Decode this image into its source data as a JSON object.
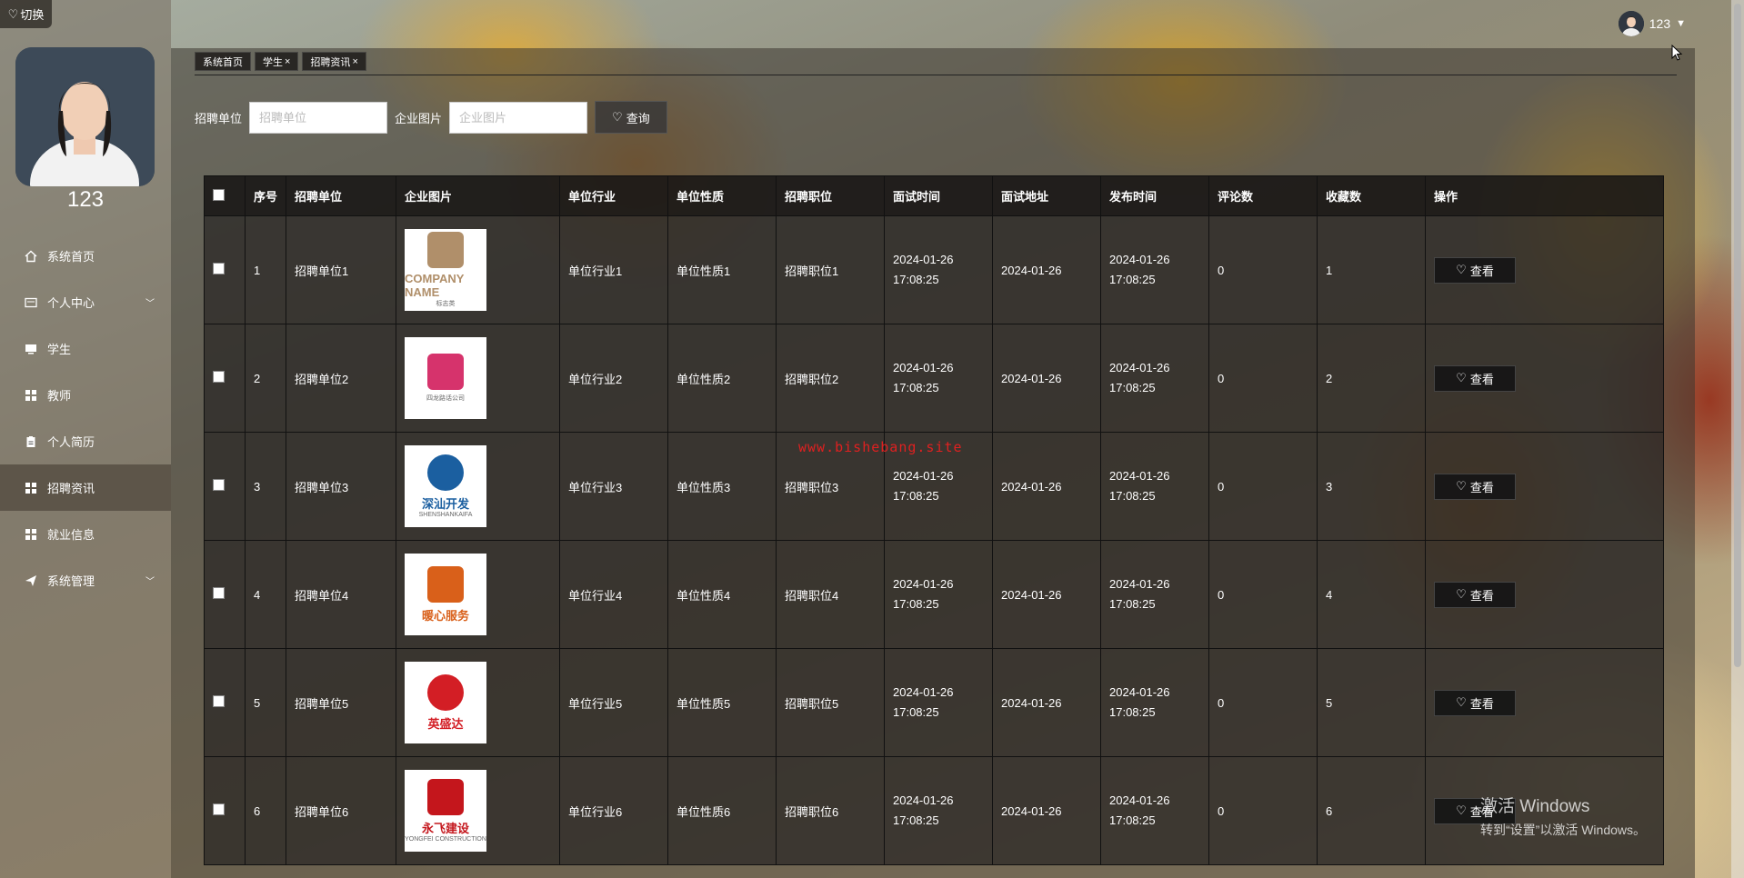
{
  "sidebar": {
    "switch_label": "切换",
    "username": "123",
    "items": [
      {
        "label": "系统首页",
        "icon": "home-icon"
      },
      {
        "label": "个人中心",
        "icon": "id-card-icon",
        "has_submenu": true
      },
      {
        "label": "学生",
        "icon": "monitor-icon"
      },
      {
        "label": "教师",
        "icon": "grid-icon"
      },
      {
        "label": "个人简历",
        "icon": "clipboard-icon"
      },
      {
        "label": "招聘资讯",
        "icon": "grid-icon",
        "active": true
      },
      {
        "label": "就业信息",
        "icon": "grid-icon"
      },
      {
        "label": "系统管理",
        "icon": "paper-plane-icon",
        "has_submenu": true
      }
    ]
  },
  "topbar": {
    "user_label": "123"
  },
  "tags": [
    {
      "label": "系统首页",
      "closable": false
    },
    {
      "label": "学生",
      "closable": true
    },
    {
      "label": "招聘资讯",
      "closable": true
    }
  ],
  "search": {
    "company_label": "招聘单位",
    "company_placeholder": "招聘单位",
    "image_label": "企业图片",
    "image_placeholder": "企业图片",
    "query_button": "查询"
  },
  "table": {
    "headers": [
      "序号",
      "招聘单位",
      "企业图片",
      "单位行业",
      "单位性质",
      "招聘职位",
      "面试时间",
      "面试地址",
      "发布时间",
      "评论数",
      "收藏数",
      "操作"
    ],
    "view_label": "查看",
    "rows": [
      {
        "no": "1",
        "company": "招聘单位1",
        "logo_text": "COMPANY NAME",
        "logo_sub": "标志类",
        "logo_color": "#b08f6a",
        "industry": "单位行业1",
        "nature": "单位性质1",
        "position": "招聘职位1",
        "interview_time": "2024-01-26 17:08:25",
        "address": "2024-01-26",
        "publish_time": "2024-01-26 17:08:25",
        "comments": "0",
        "favorites": "1"
      },
      {
        "no": "2",
        "company": "招聘单位2",
        "logo_text": "",
        "logo_sub": "四龙路话公司",
        "logo_color": "#d6336c",
        "industry": "单位行业2",
        "nature": "单位性质2",
        "position": "招聘职位2",
        "interview_time": "2024-01-26 17:08:25",
        "address": "2024-01-26",
        "publish_time": "2024-01-26 17:08:25",
        "comments": "0",
        "favorites": "2"
      },
      {
        "no": "3",
        "company": "招聘单位3",
        "logo_text": "深汕开发",
        "logo_sub": "SHENSHANKAIFA",
        "logo_color": "#1b5fa0",
        "industry": "单位行业3",
        "nature": "单位性质3",
        "position": "招聘职位3",
        "interview_time": "2024-01-26 17:08:25",
        "address": "2024-01-26",
        "publish_time": "2024-01-26 17:08:25",
        "comments": "0",
        "favorites": "3"
      },
      {
        "no": "4",
        "company": "招聘单位4",
        "logo_text": "暖心服务",
        "logo_sub": "",
        "logo_color": "#d9601a",
        "industry": "单位行业4",
        "nature": "单位性质4",
        "position": "招聘职位4",
        "interview_time": "2024-01-26 17:08:25",
        "address": "2024-01-26",
        "publish_time": "2024-01-26 17:08:25",
        "comments": "0",
        "favorites": "4"
      },
      {
        "no": "5",
        "company": "招聘单位5",
        "logo_text": "英盛达",
        "logo_sub": "",
        "logo_color": "#d31e25",
        "industry": "单位行业5",
        "nature": "单位性质5",
        "position": "招聘职位5",
        "interview_time": "2024-01-26 17:08:25",
        "address": "2024-01-26",
        "publish_time": "2024-01-26 17:08:25",
        "comments": "0",
        "favorites": "5"
      },
      {
        "no": "6",
        "company": "招聘单位6",
        "logo_text": "永飞建设",
        "logo_sub": "YONGFEI CONSTRUCTION",
        "logo_color": "#c4161c",
        "industry": "单位行业6",
        "nature": "单位性质6",
        "position": "招聘职位6",
        "interview_time": "2024-01-26 17:08:25",
        "address": "2024-01-26",
        "publish_time": "2024-01-26 17:08:25",
        "comments": "0",
        "favorites": "6"
      }
    ]
  },
  "watermark": "www.bishebang.site",
  "windows_activation": {
    "line1": "激活 Windows",
    "line2": "转到“设置”以激活 Windows。"
  }
}
